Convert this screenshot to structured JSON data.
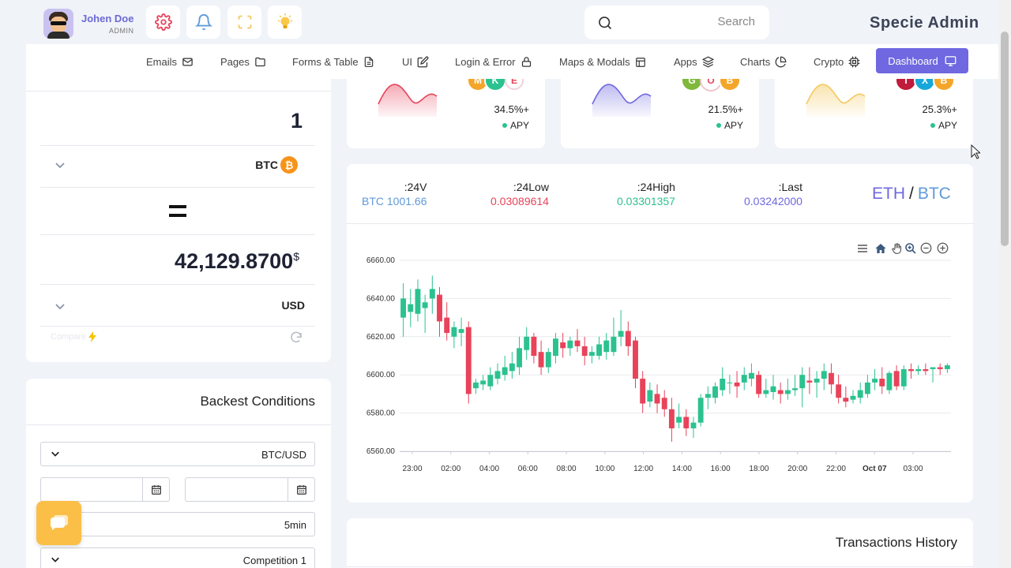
{
  "user": {
    "name": "Johen Doe",
    "role": "ADMIN"
  },
  "search": {
    "placeholder": "Search"
  },
  "brand": "Specie Admin",
  "nav": [
    {
      "label": "Emails",
      "icon": "mail-icon"
    },
    {
      "label": "Pages",
      "icon": "folder-icon"
    },
    {
      "label": "Forms & Table",
      "icon": "file-icon"
    },
    {
      "label": "UI",
      "icon": "edit-icon"
    },
    {
      "label": "Login & Error",
      "icon": "lock-icon"
    },
    {
      "label": "Maps & Modals",
      "icon": "layout-icon"
    },
    {
      "label": "Apps",
      "icon": "layers-icon"
    },
    {
      "label": "Charts",
      "icon": "pie-chart-icon"
    },
    {
      "label": "Crypto",
      "icon": "cpu-icon"
    },
    {
      "label": "Dashboard",
      "icon": "monitor-icon"
    }
  ],
  "converter": {
    "amount": "1",
    "from_currency": "BTC",
    "from_icon": "bitcoin-icon",
    "result": "42,129.8700",
    "result_symbol": "$",
    "to_currency": "USD",
    "compare_label": "Compare",
    "refresh_icon": "refresh-icon"
  },
  "backtest": {
    "title": "Backest Conditions",
    "pair": "BTC/USD",
    "date_from": "",
    "date_to": "",
    "timeframe": "5min",
    "competition": "Competition 1"
  },
  "stats": [
    {
      "pct": "34.5%+",
      "apy": "APY",
      "color": "#e8435a",
      "coins": [
        "M",
        "K",
        "E"
      ]
    },
    {
      "pct": "21.5%+",
      "apy": "APY",
      "color": "#6f68e0",
      "coins": [
        "G",
        "O",
        "B"
      ]
    },
    {
      "pct": "25.3%+",
      "apy": "APY",
      "color": "#f4c95d",
      "coins": [
        "T",
        "X",
        "B"
      ]
    }
  ],
  "ticker": {
    "vol_label": ":24V",
    "vol_value": "BTC 1001.66",
    "low_label": ":24Low",
    "low_value": "0.03089614",
    "high_label": ":24High",
    "high_value": "0.03301357",
    "last_label": ":Last",
    "last_value": "0.03242000",
    "pair_base": "ETH",
    "pair_sep": "/",
    "pair_quote": "BTC"
  },
  "transactions": {
    "title": "Transactions History"
  },
  "colors": {
    "accent": "#6f68e0",
    "up": "#2bc28f",
    "down": "#e8435a",
    "gold": "#fbbf47"
  },
  "chart_data": {
    "type": "candlestick",
    "y_ticks": [
      "6560.00",
      "6580.00",
      "6600.00",
      "6620.00",
      "6640.00",
      "6660.00"
    ],
    "ylim": [
      6560,
      6660
    ],
    "x_ticks": [
      "23:00",
      "02:00",
      "04:00",
      "06:00",
      "08:00",
      "10:00",
      "12:00",
      "14:00",
      "16:00",
      "18:00",
      "20:00",
      "22:00",
      "Oct 07",
      "03:00"
    ],
    "toolbar_icons": [
      "menu-icon",
      "home-icon",
      "pan-icon",
      "zoom-in-icon",
      "zoom-out-icon",
      "zoom-reset-icon"
    ],
    "candles": [
      {
        "o": 6630,
        "h": 6648,
        "c": 6640,
        "l": 6620
      },
      {
        "o": 6633,
        "h": 6645,
        "c": 6637,
        "l": 6625
      },
      {
        "o": 6632,
        "h": 6650,
        "c": 6645,
        "l": 6628
      },
      {
        "o": 6635,
        "h": 6642,
        "c": 6638,
        "l": 6622
      },
      {
        "o": 6640,
        "h": 6652,
        "c": 6645,
        "l": 6632
      },
      {
        "o": 6642,
        "h": 6646,
        "c": 6628,
        "l": 6620
      },
      {
        "o": 6630,
        "h": 6638,
        "c": 6622,
        "l": 6618
      },
      {
        "o": 6620,
        "h": 6628,
        "c": 6625,
        "l": 6614
      },
      {
        "o": 6622,
        "h": 6630,
        "c": 6624,
        "l": 6615
      },
      {
        "o": 6625,
        "h": 6628,
        "c": 6590,
        "l": 6585
      },
      {
        "o": 6593,
        "h": 6598,
        "c": 6596,
        "l": 6590
      },
      {
        "o": 6595,
        "h": 6600,
        "c": 6597,
        "l": 6592
      },
      {
        "o": 6594,
        "h": 6604,
        "c": 6600,
        "l": 6592
      },
      {
        "o": 6598,
        "h": 6606,
        "c": 6602,
        "l": 6595
      },
      {
        "o": 6600,
        "h": 6610,
        "c": 6604,
        "l": 6597
      },
      {
        "o": 6602,
        "h": 6612,
        "c": 6606,
        "l": 6598
      },
      {
        "o": 6604,
        "h": 6620,
        "c": 6614,
        "l": 6600
      },
      {
        "o": 6613,
        "h": 6625,
        "c": 6620,
        "l": 6608
      },
      {
        "o": 6620,
        "h": 6622,
        "c": 6610,
        "l": 6606
      },
      {
        "o": 6612,
        "h": 6618,
        "c": 6604,
        "l": 6600
      },
      {
        "o": 6604,
        "h": 6614,
        "c": 6612,
        "l": 6601
      },
      {
        "o": 6610,
        "h": 6622,
        "c": 6619,
        "l": 6606
      },
      {
        "o": 6617,
        "h": 6622,
        "c": 6614,
        "l": 6609
      },
      {
        "o": 6614,
        "h": 6620,
        "c": 6618,
        "l": 6610
      },
      {
        "o": 6618,
        "h": 6624,
        "c": 6615,
        "l": 6612
      },
      {
        "o": 6615,
        "h": 6620,
        "c": 6610,
        "l": 6605
      },
      {
        "o": 6610,
        "h": 6615,
        "c": 6612,
        "l": 6606
      },
      {
        "o": 6610,
        "h": 6620,
        "c": 6616,
        "l": 6608
      },
      {
        "o": 6612,
        "h": 6622,
        "c": 6618,
        "l": 6608
      },
      {
        "o": 6612,
        "h": 6630,
        "c": 6620,
        "l": 6610
      },
      {
        "o": 6620,
        "h": 6634,
        "c": 6623,
        "l": 6615
      },
      {
        "o": 6623,
        "h": 6628,
        "c": 6615,
        "l": 6610
      },
      {
        "o": 6618,
        "h": 6620,
        "c": 6598,
        "l": 6593
      },
      {
        "o": 6598,
        "h": 6602,
        "c": 6585,
        "l": 6580
      },
      {
        "o": 6586,
        "h": 6596,
        "c": 6592,
        "l": 6583
      },
      {
        "o": 6590,
        "h": 6595,
        "c": 6585,
        "l": 6580
      },
      {
        "o": 6588,
        "h": 6592,
        "c": 6582,
        "l": 6578
      },
      {
        "o": 6582,
        "h": 6588,
        "c": 6572,
        "l": 6565
      },
      {
        "o": 6575,
        "h": 6585,
        "c": 6578,
        "l": 6572
      },
      {
        "o": 6578,
        "h": 6582,
        "c": 6572,
        "l": 6568
      },
      {
        "o": 6572,
        "h": 6578,
        "c": 6575,
        "l": 6567
      },
      {
        "o": 6575,
        "h": 6590,
        "c": 6588,
        "l": 6573
      },
      {
        "o": 6588,
        "h": 6594,
        "c": 6590,
        "l": 6582
      },
      {
        "o": 6588,
        "h": 6596,
        "c": 6594,
        "l": 6585
      },
      {
        "o": 6592,
        "h": 6604,
        "c": 6598,
        "l": 6589
      },
      {
        "o": 6596,
        "h": 6600,
        "c": 6596,
        "l": 6590
      },
      {
        "o": 6596,
        "h": 6602,
        "c": 6594,
        "l": 6588
      },
      {
        "o": 6596,
        "h": 6604,
        "c": 6600,
        "l": 6592
      },
      {
        "o": 6598,
        "h": 6606,
        "c": 6601,
        "l": 6594
      },
      {
        "o": 6600,
        "h": 6602,
        "c": 6590,
        "l": 6588
      },
      {
        "o": 6590,
        "h": 6598,
        "c": 6592,
        "l": 6588
      },
      {
        "o": 6591,
        "h": 6600,
        "c": 6594,
        "l": 6587
      },
      {
        "o": 6592,
        "h": 6596,
        "c": 6590,
        "l": 6585
      },
      {
        "o": 6590,
        "h": 6598,
        "c": 6592,
        "l": 6587
      },
      {
        "o": 6592,
        "h": 6600,
        "c": 6593,
        "l": 6589
      },
      {
        "o": 6593,
        "h": 6604,
        "c": 6600,
        "l": 6583
      },
      {
        "o": 6597,
        "h": 6604,
        "c": 6596,
        "l": 6590
      },
      {
        "o": 6596,
        "h": 6602,
        "c": 6598,
        "l": 6588
      },
      {
        "o": 6598,
        "h": 6606,
        "c": 6602,
        "l": 6592
      },
      {
        "o": 6601,
        "h": 6606,
        "c": 6595,
        "l": 6590
      },
      {
        "o": 6595,
        "h": 6600,
        "c": 6588,
        "l": 6585
      },
      {
        "o": 6588,
        "h": 6594,
        "c": 6586,
        "l": 6583
      },
      {
        "o": 6587,
        "h": 6592,
        "c": 6589,
        "l": 6585
      },
      {
        "o": 6588,
        "h": 6596,
        "c": 6592,
        "l": 6585
      },
      {
        "o": 6590,
        "h": 6600,
        "c": 6596,
        "l": 6588
      },
      {
        "o": 6596,
        "h": 6603,
        "c": 6598,
        "l": 6592
      },
      {
        "o": 6598,
        "h": 6604,
        "c": 6594,
        "l": 6590
      },
      {
        "o": 6592,
        "h": 6602,
        "c": 6601,
        "l": 6590
      },
      {
        "o": 6602,
        "h": 6605,
        "c": 6594,
        "l": 6592
      },
      {
        "o": 6594,
        "h": 6605,
        "c": 6603,
        "l": 6592
      },
      {
        "o": 6603,
        "h": 6606,
        "c": 6602,
        "l": 6598
      },
      {
        "o": 6602,
        "h": 6605,
        "c": 6603,
        "l": 6600
      },
      {
        "o": 6603,
        "h": 6606,
        "c": 6602,
        "l": 6600
      },
      {
        "o": 6603,
        "h": 6604,
        "c": 6604,
        "l": 6596
      },
      {
        "o": 6604,
        "h": 6606,
        "c": 6603,
        "l": 6600
      },
      {
        "o": 6603,
        "h": 6606,
        "c": 6605,
        "l": 6601
      }
    ]
  }
}
